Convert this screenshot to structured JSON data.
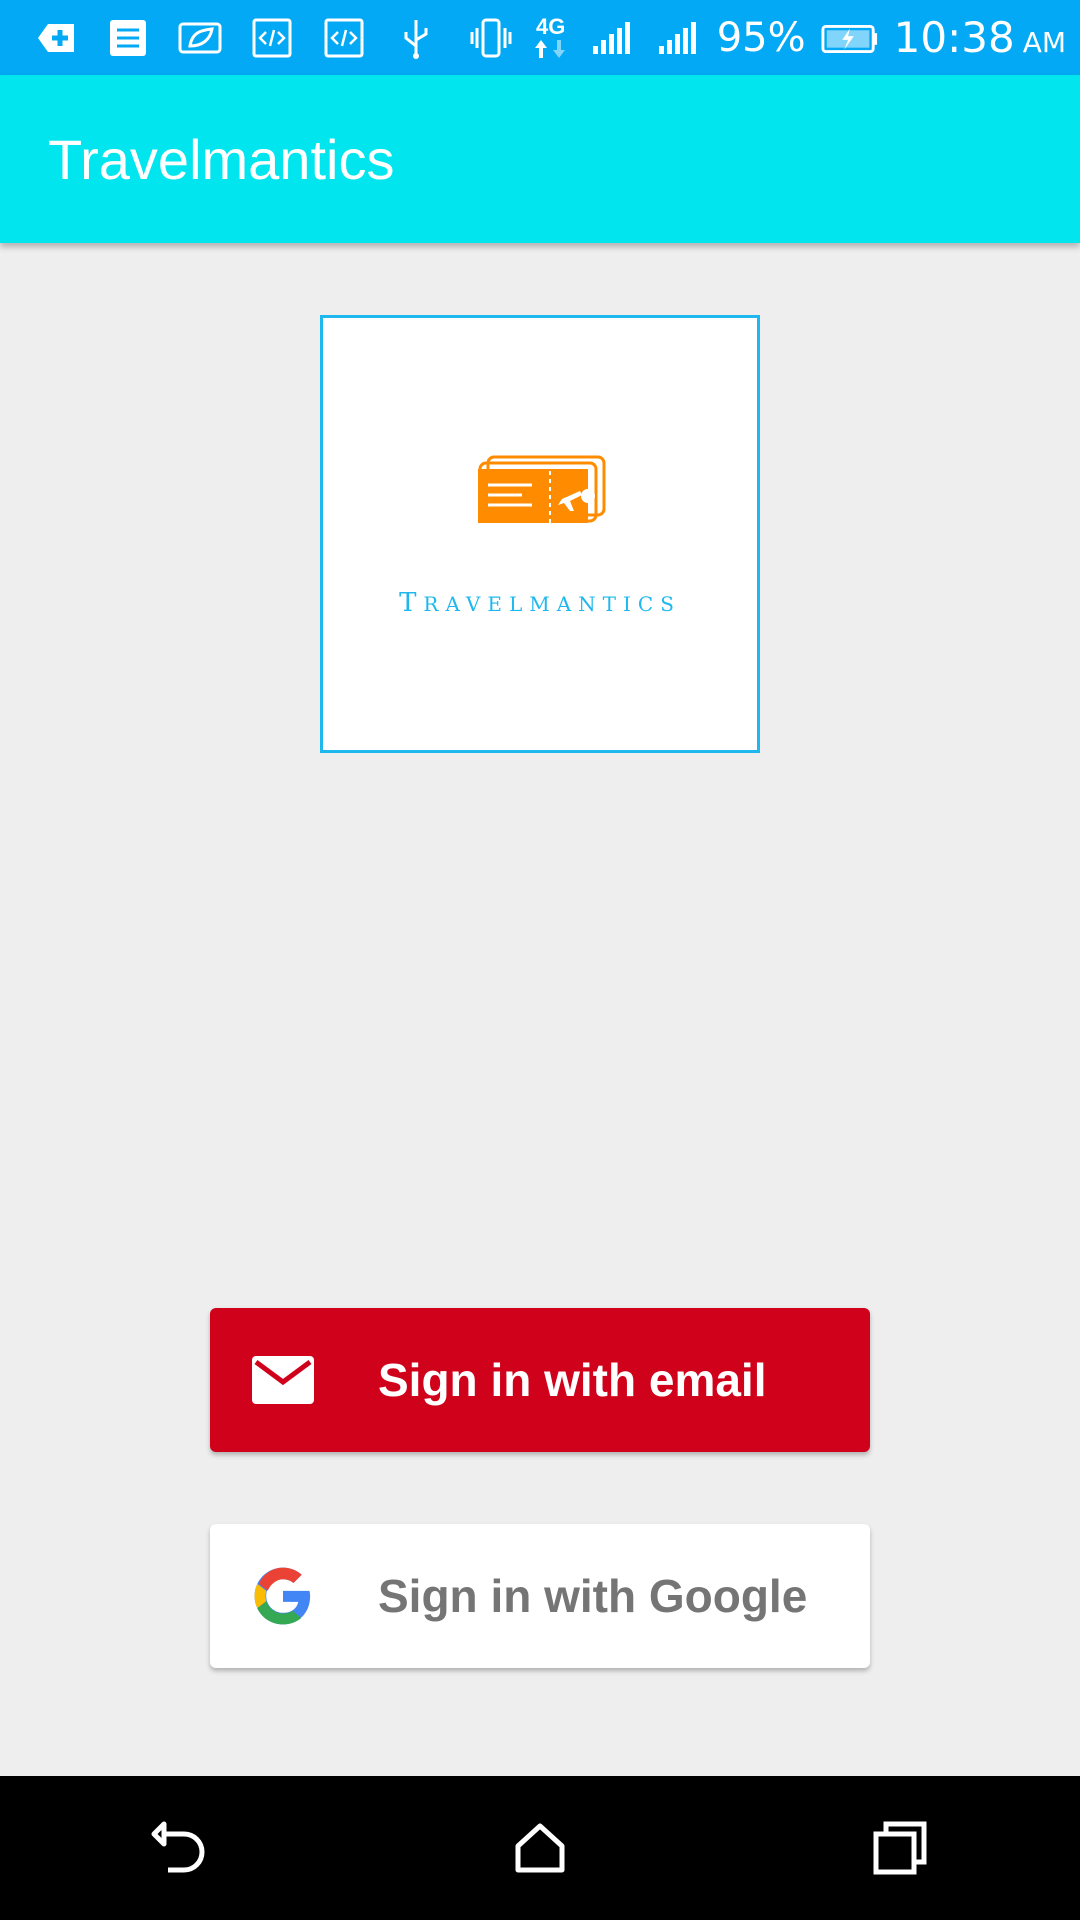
{
  "status_bar": {
    "network_type": "4G",
    "battery_percent": "95%",
    "time": "10:38",
    "ampm": "AM",
    "icons": [
      "add-icon",
      "document-icon",
      "leaf-icon",
      "code-icon",
      "code-icon",
      "usb-icon",
      "vibrate-icon",
      "signal-icon",
      "signal-icon",
      "battery-charging-icon"
    ]
  },
  "app_bar": {
    "title": "Travelmantics",
    "color": "#00e5ee"
  },
  "logo": {
    "text": "Travelmantics",
    "icon": "ticket-plane-icon",
    "accent": "#1fb8ee",
    "icon_color": "#ff8c00"
  },
  "buttons": {
    "email": {
      "label": "Sign in with email",
      "icon": "mail-icon",
      "color": "#d0021b"
    },
    "google": {
      "label": "Sign in with Google",
      "icon": "google-g-icon",
      "color": "#ffffff"
    }
  },
  "nav_bar": {
    "items": [
      "back-icon",
      "home-icon",
      "recents-icon"
    ]
  }
}
